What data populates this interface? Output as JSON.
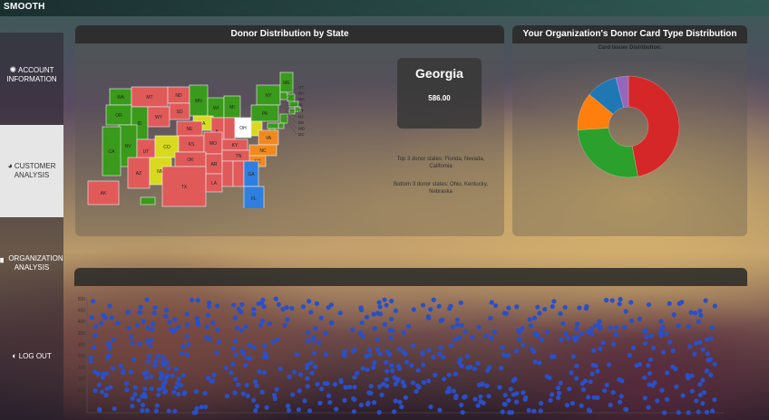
{
  "app": {
    "brand": "SMOOTH"
  },
  "nav": [
    {
      "icon": "gear-icon",
      "label": "ACCOUNT INFORMATION",
      "active": false
    },
    {
      "icon": "pie-icon",
      "label": "CUSTOMER ANALYSIS",
      "active": true
    },
    {
      "icon": "bar-chart-icon",
      "label": "ORGANIZATION ANALYSIS",
      "active": false
    },
    {
      "icon": "power-icon",
      "label": "LOG OUT",
      "active": false
    }
  ],
  "map_panel": {
    "title": "Donor Distribution by State",
    "selected_state": "Georgia",
    "selected_value": "586.00",
    "top_states": "Top 3 donor states: Florida, Nevada, California",
    "bottom_states": "Bottom 3 donor states: Ohio, Kentucky, Nebraska",
    "state_labels": [
      "WA",
      "MT",
      "ND",
      "MN",
      "WI",
      "MI",
      "NY",
      "ME",
      "OR",
      "ID",
      "WY",
      "SD",
      "IA",
      "IL",
      "IN",
      "OH",
      "PA",
      "VT",
      "NH",
      "MA",
      "RI",
      "CT",
      "NJ",
      "DE",
      "MD",
      "DC",
      "NV",
      "UT",
      "CO",
      "NE",
      "KS",
      "MO",
      "KY",
      "WV",
      "VA",
      "CA",
      "AZ",
      "NM",
      "OK",
      "AR",
      "TN",
      "NC",
      "SC",
      "TX",
      "LA",
      "MS",
      "AL",
      "GA",
      "FL",
      "AK",
      "HI"
    ],
    "colors": {
      "high": "#3a9a1c",
      "low": "#e05a5a",
      "mid": "#d9d91f",
      "selected": "#2f7fe0",
      "orange": "#f08a20",
      "white": "#ffffff"
    }
  },
  "donut_panel": {
    "title": "Your Organization's Donor Card Type Distribution",
    "subtitle": "Card Issuer Distribution:"
  },
  "chart_data": [
    {
      "type": "pie",
      "title": "Card Issuer Distribution:",
      "values": [
        47,
        27,
        12,
        10,
        4
      ],
      "colors": [
        "#d62728",
        "#2ca02c",
        "#ff7f0e",
        "#1f77b4",
        "#9467bd"
      ]
    },
    {
      "type": "scatter",
      "ylim": [
        0,
        500
      ],
      "yticks": [
        0,
        50,
        100,
        150,
        200,
        250,
        300,
        350,
        400,
        450,
        500
      ],
      "color": "#2a4fc8"
    }
  ]
}
